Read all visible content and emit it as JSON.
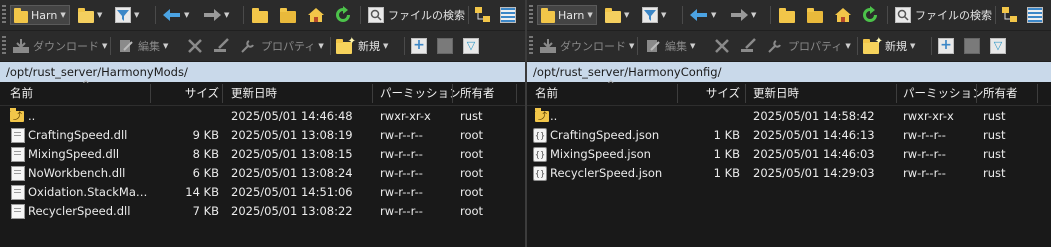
{
  "left": {
    "toolbar1": {
      "folder_label": "Harn",
      "find_label": "ファイルの検索"
    },
    "toolbar2": {
      "download_label": "ダウンロード",
      "edit_label": "編集",
      "properties_label": "プロパティ",
      "new_label": "新規"
    },
    "path": "/opt/rust_server/HarmonyMods/",
    "columns": {
      "name": "名前",
      "size": "サイズ",
      "modified": "更新日時",
      "permissions": "パーミッション",
      "owner": "所有者"
    },
    "rows": [
      {
        "type": "parent",
        "name": "..",
        "size": "",
        "modified": "2025/05/01 14:46:48",
        "permissions": "rwxr-xr-x",
        "owner": "rust"
      },
      {
        "type": "file",
        "name": "CraftingSpeed.dll",
        "size": "9 KB",
        "modified": "2025/05/01 13:08:19",
        "permissions": "rw-r--r--",
        "owner": "root"
      },
      {
        "type": "file",
        "name": "MixingSpeed.dll",
        "size": "8 KB",
        "modified": "2025/05/01 13:08:15",
        "permissions": "rw-r--r--",
        "owner": "root"
      },
      {
        "type": "file",
        "name": "NoWorkbench.dll",
        "size": "6 KB",
        "modified": "2025/05/01 13:08:24",
        "permissions": "rw-r--r--",
        "owner": "root"
      },
      {
        "type": "file",
        "name": "Oxidation.StackMana...",
        "size": "14 KB",
        "modified": "2025/05/01 14:51:06",
        "permissions": "rw-r--r--",
        "owner": "root"
      },
      {
        "type": "file",
        "name": "RecyclerSpeed.dll",
        "size": "7 KB",
        "modified": "2025/05/01 13:08:22",
        "permissions": "rw-r--r--",
        "owner": "root"
      }
    ]
  },
  "right": {
    "toolbar1": {
      "folder_label": "Harn",
      "find_label": "ファイルの検索"
    },
    "toolbar2": {
      "download_label": "ダウンロード",
      "edit_label": "編集",
      "properties_label": "プロパティ",
      "new_label": "新規"
    },
    "path": "/opt/rust_server/HarmonyConfig/",
    "columns": {
      "name": "名前",
      "size": "サイズ",
      "modified": "更新日時",
      "permissions": "パーミッション",
      "owner": "所有者"
    },
    "rows": [
      {
        "type": "parent",
        "name": "..",
        "size": "",
        "modified": "2025/05/01 14:58:42",
        "permissions": "rwxr-xr-x",
        "owner": "rust"
      },
      {
        "type": "json",
        "name": "CraftingSpeed.json",
        "size": "1 KB",
        "modified": "2025/05/01 14:46:13",
        "permissions": "rw-r--r--",
        "owner": "rust"
      },
      {
        "type": "json",
        "name": "MixingSpeed.json",
        "size": "1 KB",
        "modified": "2025/05/01 14:46:03",
        "permissions": "rw-r--r--",
        "owner": "rust"
      },
      {
        "type": "json",
        "name": "RecyclerSpeed.json",
        "size": "1 KB",
        "modified": "2025/05/01 14:29:03",
        "permissions": "rw-r--r--",
        "owner": "rust"
      }
    ]
  },
  "icons": {
    "folder_dropdown": "folder-icon",
    "open_folder": "open-folder-icon",
    "filter": "filter-icon",
    "back": "back-arrow-icon",
    "forward": "forward-arrow-icon",
    "parent_dir": "parent-directory-icon",
    "root_dir": "root-directory-icon",
    "home": "home-icon",
    "refresh": "refresh-icon",
    "find": "find-files-icon",
    "tree": "tree-view-icon",
    "view": "view-mode-icon",
    "download": "download-icon",
    "edit": "edit-icon",
    "delete": "delete-icon",
    "rename": "rename-icon",
    "properties": "properties-icon",
    "new": "new-icon",
    "plus": "select-plus-icon",
    "minus": "select-minus-icon",
    "invert": "select-invert-icon"
  },
  "colors": {
    "path_bar": "#c9d9ea",
    "accent_blue": "#4ba3e3",
    "refresh_green": "#4cc24a",
    "folder_yellow": "#f2c649",
    "background": "#191919"
  }
}
